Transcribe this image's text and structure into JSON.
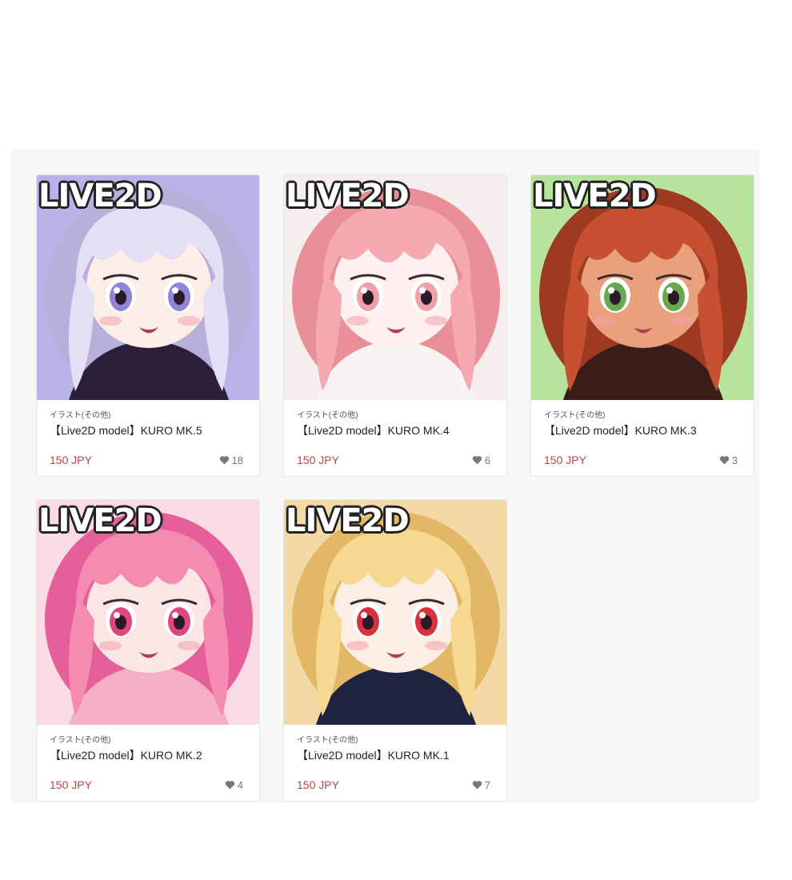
{
  "products": [
    {
      "banner": "LIVE2D",
      "category": "イラスト(その他)",
      "title": "【Live2D model】KURO MK.5",
      "price": "150 JPY",
      "likes": "18",
      "palette": {
        "bg": "#b9b3ea",
        "hair": "#e4dff5",
        "hair_shade": "#b8b0da",
        "skin": "#fbeee9",
        "eye": "#8f86d8",
        "cloth": "#2b1f3a"
      }
    },
    {
      "banner": "LIVE2D",
      "category": "イラスト(その他)",
      "title": "【Live2D model】KURO MK.4",
      "price": "150 JPY",
      "likes": "6",
      "palette": {
        "bg": "#f6eeee",
        "hair": "#f4aab0",
        "hair_shade": "#e88f98",
        "skin": "#fdf0ee",
        "eye": "#f2a0a8",
        "cloth": "#f8f4f4"
      }
    },
    {
      "banner": "LIVE2D",
      "category": "イラスト(その他)",
      "title": "【Live2D model】KURO MK.3",
      "price": "150 JPY",
      "likes": "3",
      "palette": {
        "bg": "#b8e39c",
        "hair": "#c6502f",
        "hair_shade": "#9e3a22",
        "skin": "#e9a07d",
        "eye": "#6aa84f",
        "cloth": "#3a1c18"
      }
    },
    {
      "banner": "LIVE2D",
      "category": "イラスト(その他)",
      "title": "【Live2D model】KURO MK.2",
      "price": "150 JPY",
      "likes": "4",
      "palette": {
        "bg": "#f9dbe3",
        "hair": "#f58bb0",
        "hair_shade": "#e5609a",
        "skin": "#fbe6e6",
        "eye": "#e0457d",
        "cloth": "#f4b1c6"
      }
    },
    {
      "banner": "LIVE2D",
      "category": "イラスト(その他)",
      "title": "【Live2D model】KURO MK.1",
      "price": "150 JPY",
      "likes": "7",
      "palette": {
        "bg": "#f3d9a6",
        "hair": "#f6d890",
        "hair_shade": "#e2b866",
        "skin": "#fbeee5",
        "eye": "#d8323c",
        "cloth": "#1f2240"
      }
    }
  ]
}
